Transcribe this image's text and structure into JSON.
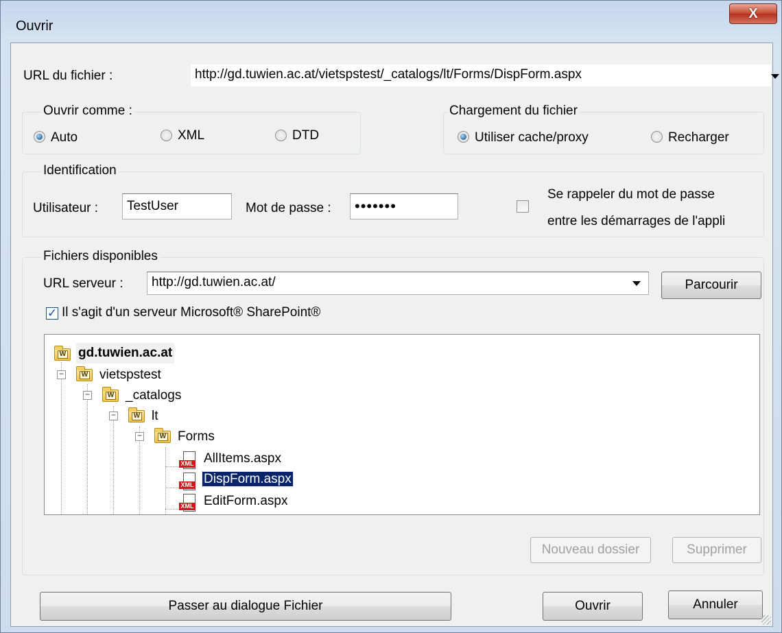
{
  "window": {
    "title": "Ouvrir",
    "close_label": "X"
  },
  "file_url": {
    "label": "URL du fichier :",
    "value": "http://gd.tuwien.ac.at/vietspstest/_catalogs/lt/Forms/DispForm.aspx"
  },
  "open_as": {
    "title": "Ouvrir comme :",
    "options": [
      "Auto",
      "XML",
      "DTD"
    ],
    "selected": "Auto"
  },
  "file_loading": {
    "title": "Chargement du fichier",
    "options": [
      "Utiliser cache/proxy",
      "Recharger"
    ],
    "selected": "Utiliser cache/proxy"
  },
  "identification": {
    "title": "Identification",
    "user_label": "Utilisateur :",
    "user_value": "TestUser",
    "password_label": "Mot de passe :",
    "password_mask": "•••••••",
    "remember_line1": "Se rappeler du mot de passe",
    "remember_line2": "entre les démarrages de l'appli",
    "remember_checked": false
  },
  "available_files": {
    "title": "Fichiers disponibles",
    "server_url_label": "URL serveur :",
    "server_url_value": "http://gd.tuwien.ac.at/",
    "browse_label": "Parcourir",
    "sharepoint_label": "Il s'agit d'un serveur Microsoft® SharePoint®",
    "sharepoint_checked": true,
    "tree": {
      "root": "gd.tuwien.ac.at",
      "folders": [
        "vietspstest",
        "_catalogs",
        "lt",
        "Forms"
      ],
      "files": [
        "AllItems.aspx",
        "DispForm.aspx",
        "EditForm.aspx"
      ],
      "selected_file": "DispForm.aspx",
      "folder_badge": "W",
      "file_badge": "XML"
    },
    "new_folder_label": "Nouveau dossier",
    "delete_label": "Supprimer"
  },
  "footer": {
    "switch_label": "Passer au dialogue Fichier",
    "open_label": "Ouvrir",
    "cancel_label": "Annuler"
  }
}
